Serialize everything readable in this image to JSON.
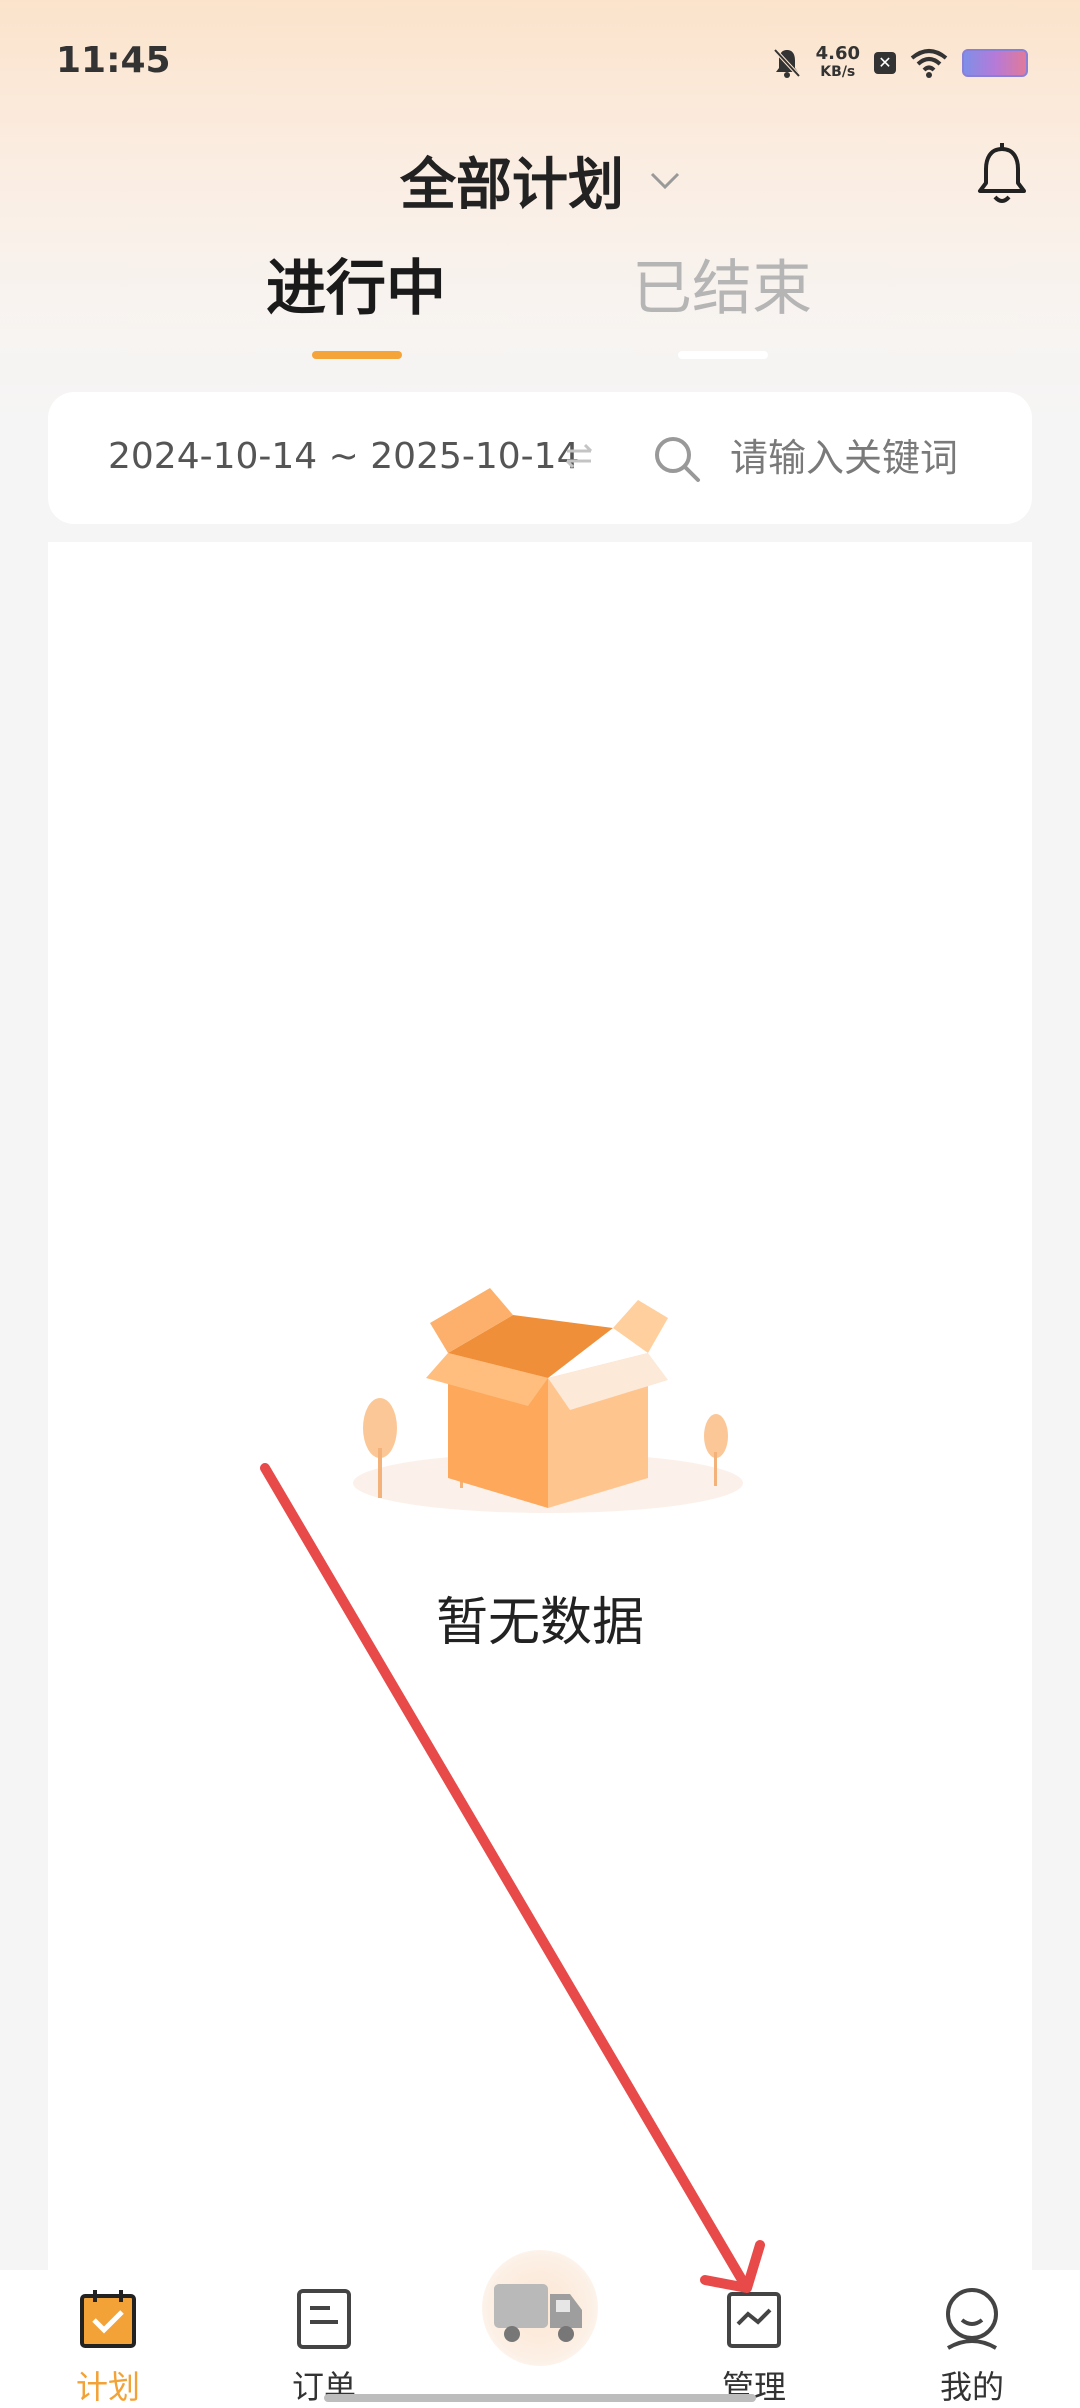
{
  "status_bar": {
    "time": "11:45",
    "net_speed_value": "4.60",
    "net_speed_unit": "KB/s",
    "icons": [
      "mute-bell-icon",
      "close-box-icon",
      "wifi-icon",
      "battery-icon"
    ]
  },
  "header": {
    "title": "全部计划",
    "icons": [
      "chevron-down-icon",
      "bell-icon"
    ]
  },
  "tabs": [
    {
      "label": "进行中",
      "active": true
    },
    {
      "label": "已结束",
      "active": false
    }
  ],
  "filter": {
    "date_range": "2024-10-14 ~ 2025-10-14",
    "search_placeholder": "请输入关键词"
  },
  "empty_state": {
    "message": "暂无数据"
  },
  "bottom_nav": {
    "items": [
      {
        "label": "计划",
        "icon": "calendar-check-icon",
        "active": true
      },
      {
        "label": "订单",
        "icon": "document-icon",
        "active": false
      },
      {
        "label": "",
        "icon": "truck-icon",
        "active": false
      },
      {
        "label": "管理",
        "icon": "chart-icon",
        "active": false
      },
      {
        "label": "我的",
        "icon": "user-icon",
        "active": false
      }
    ]
  },
  "colors": {
    "accent": "#f5a43a",
    "annotation_arrow": "#e84a4a"
  }
}
